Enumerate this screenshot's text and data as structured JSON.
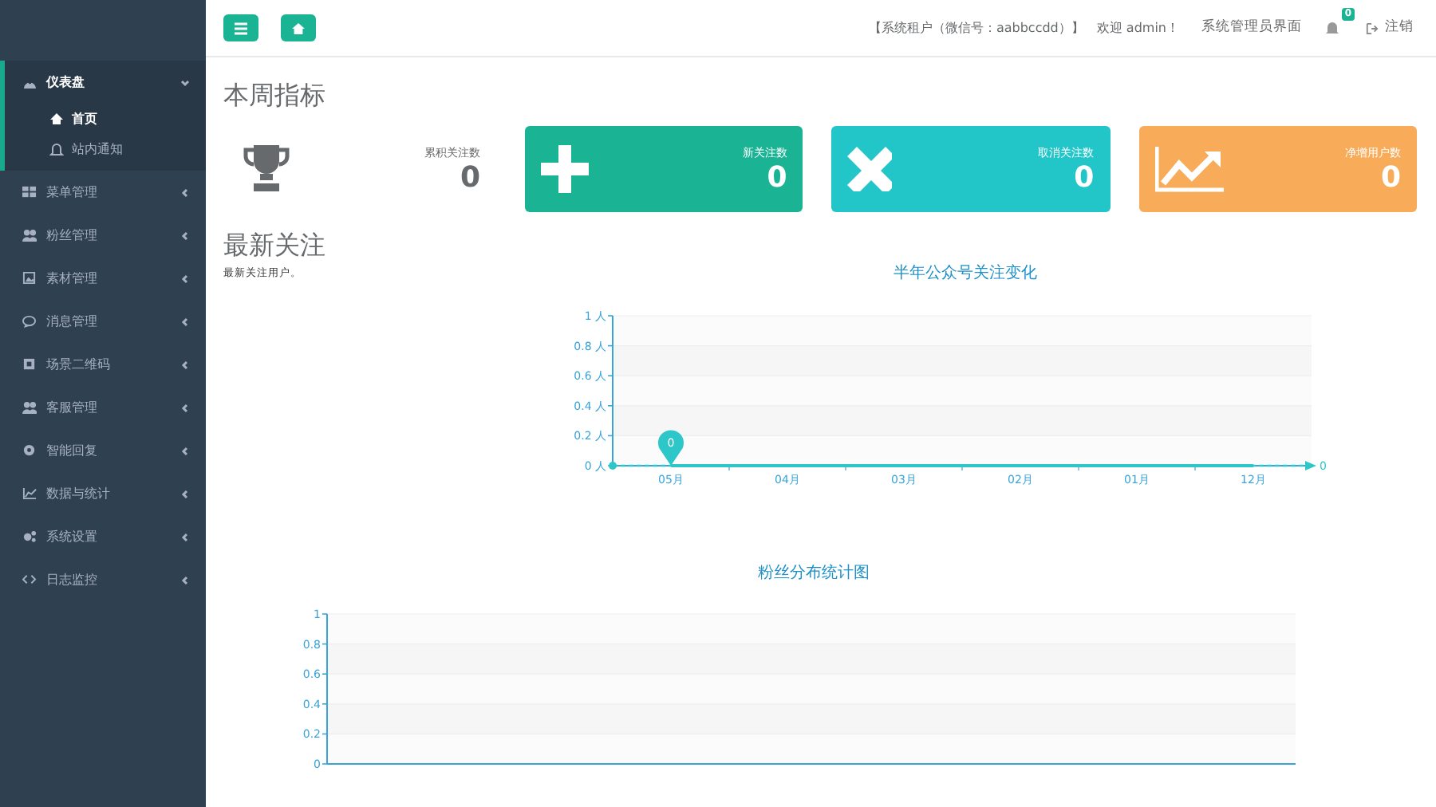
{
  "sidebar": {
    "items": [
      {
        "label": "仪表盘",
        "selected": true,
        "expanded": true,
        "children": [
          {
            "label": "首页",
            "selected": true
          },
          {
            "label": "站内通知",
            "selected": false
          }
        ]
      },
      {
        "label": "菜单管理",
        "selected": false,
        "expanded": false
      },
      {
        "label": "粉丝管理",
        "selected": false,
        "expanded": false
      },
      {
        "label": "素材管理",
        "selected": false,
        "expanded": false
      },
      {
        "label": "消息管理",
        "selected": false,
        "expanded": false
      },
      {
        "label": "场景二维码",
        "selected": false,
        "expanded": false
      },
      {
        "label": "客服管理",
        "selected": false,
        "expanded": false
      },
      {
        "label": "智能回复",
        "selected": false,
        "expanded": false
      },
      {
        "label": "数据与统计",
        "selected": false,
        "expanded": false
      },
      {
        "label": "系统设置",
        "selected": false,
        "expanded": false
      },
      {
        "label": "日志监控",
        "selected": false,
        "expanded": false
      }
    ]
  },
  "header": {
    "tenant": "【系统租户（微信号：aabbccdd）】",
    "welcome": "欢迎 admin！",
    "admin_link": "系统管理员界面",
    "notification_count": "0",
    "logout": "注销"
  },
  "weekly": {
    "title": "本周指标",
    "stats": [
      {
        "kind": "plain",
        "label": "累积关注数",
        "value": "0"
      },
      {
        "kind": "tile",
        "label": "新关注数",
        "value": "0",
        "color": "#1ab394"
      },
      {
        "kind": "tile",
        "label": "取消关注数",
        "value": "0",
        "color": "#23c6c8"
      },
      {
        "kind": "tile",
        "label": "净增用户数",
        "value": "0",
        "color": "#f8ac59"
      }
    ]
  },
  "latest": {
    "title": "最新关注",
    "note": "最新关注用户。"
  },
  "charts": [
    {
      "chart_data": {
        "type": "line",
        "title": "半年公众号关注变化",
        "categories": [
          "05月",
          "04月",
          "03月",
          "02月",
          "01月",
          "12月"
        ],
        "series": [
          {
            "color": "#2ec7c9",
            "values": [
              0,
              0,
              0,
              0,
              0,
              0
            ]
          }
        ],
        "grid": true,
        "ylim": [
          0,
          1
        ],
        "yticks": [
          {
            "value": 0,
            "label": "0 人"
          },
          {
            "value": 0.2,
            "label": "0.2 人"
          },
          {
            "value": 0.4,
            "label": "0.4 人"
          },
          {
            "value": 0.6,
            "label": "0.6 人"
          },
          {
            "value": 0.8,
            "label": "0.8 人"
          },
          {
            "value": 1,
            "label": "1 人"
          }
        ],
        "annotations": [
          "0",
          "0"
        ]
      }
    },
    {
      "chart_data": {
        "type": "bar",
        "title": "粉丝分布统计图",
        "categories": [
          null
        ],
        "values": [
          null
        ],
        "grid": true,
        "ylim": [
          0,
          1
        ],
        "yticks": [
          {
            "value": 0,
            "label": "0"
          },
          {
            "value": 0.2,
            "label": "0.2"
          },
          {
            "value": 0.4,
            "label": "0.4"
          },
          {
            "value": 0.6,
            "label": "0.6"
          },
          {
            "value": 0.8,
            "label": "0.8"
          },
          {
            "value": 1,
            "label": "1"
          }
        ]
      }
    }
  ]
}
